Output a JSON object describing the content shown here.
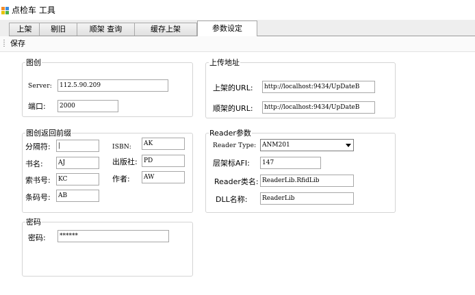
{
  "window": {
    "title": "点检车 工具",
    "icon": "app-window-icon"
  },
  "tabs": [
    {
      "label": "上架"
    },
    {
      "label": "剔旧"
    },
    {
      "label": "顺架 查询"
    },
    {
      "label": "缓存上架"
    },
    {
      "label": "参数设定",
      "active": true
    }
  ],
  "toolbar": {
    "save_label": "保存"
  },
  "tushuguan": {
    "legend": "图创",
    "server_label": "Server:",
    "server_value": "112.5.90.209",
    "port_label": "端口:",
    "port_value": "2000"
  },
  "upload": {
    "legend": "上传地址",
    "shelf_url_label": "上架的URL:",
    "shelf_url_value": "http://localhost:9434/UpDateB",
    "order_url_label": "顺架的URL:",
    "order_url_value": "http://localhost:9434/UpDateB"
  },
  "return_prefix": {
    "legend": "图创返回前缀",
    "separator_label": "分隔符:",
    "separator_value": "|",
    "isbn_label": "ISBN:",
    "isbn_value": "AK",
    "title_label": "书名:",
    "title_value": "AJ",
    "publisher_label": "出版社:",
    "publisher_value": "PD",
    "callno_label": "索书号:",
    "callno_value": "KC",
    "author_label": "作者:",
    "author_value": "AW",
    "barcode_label": "条码号:",
    "barcode_value": "AB"
  },
  "reader": {
    "legend": "Reader参数",
    "type_label": "Reader Type:",
    "type_value": "ANM201",
    "afi_label": "层架标AFI:",
    "afi_value": "147",
    "class_label": "Reader类名:",
    "class_value": "ReaderLib.RfidLib",
    "dll_label": "DLL名称:",
    "dll_value": "ReaderLib"
  },
  "password": {
    "legend": "密码",
    "label": "密码:",
    "value": "******"
  }
}
